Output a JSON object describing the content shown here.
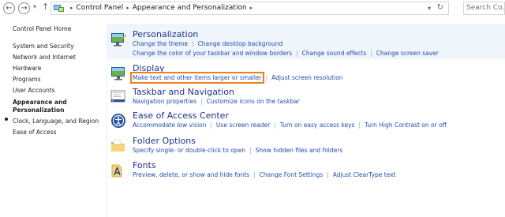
{
  "toolbar": {
    "back_icon": "back-arrow-icon",
    "forward_icon": "forward-arrow-icon",
    "recent_icon": "chevron-down-icon",
    "up_icon": "up-arrow-icon",
    "back_glyph": "←",
    "forward_glyph": "→",
    "recent_glyph": "▾",
    "up_glyph": "↑"
  },
  "address": {
    "crumbs": [
      "Control Panel",
      "Appearance and Personalization"
    ],
    "separator": "▸",
    "drop_glyph": "▾",
    "refresh_glyph": "↻"
  },
  "search": {
    "placeholder": "Search Co..."
  },
  "sidebar": {
    "items": [
      {
        "label": "Control Panel Home"
      },
      {
        "label": "System and Security"
      },
      {
        "label": "Network and Internet"
      },
      {
        "label": "Hardware"
      },
      {
        "label": "Programs"
      },
      {
        "label": "User Accounts"
      },
      {
        "label": "Appearance and"
      },
      {
        "label": "Personalization"
      },
      {
        "label": "Clock, Language, and Region"
      },
      {
        "label": "Ease of Access"
      }
    ]
  },
  "categories": [
    {
      "title": "Personalization",
      "icon": "personalization-icon",
      "lines": [
        [
          "Change the theme",
          "Change desktop background"
        ],
        [
          "Change the color of your taskbar and window borders",
          "Change sound effects",
          "Change screen saver"
        ]
      ]
    },
    {
      "title": "Display",
      "icon": "display-icon",
      "lines": [
        [
          "Make text and other items larger or smaller",
          "Adjust screen resolution"
        ]
      ]
    },
    {
      "title": "Taskbar and Navigation",
      "icon": "taskbar-icon",
      "lines": [
        [
          "Navigation properties",
          "Customize icons on the taskbar"
        ]
      ]
    },
    {
      "title": "Ease of Access Center",
      "icon": "ease-of-access-icon",
      "lines": [
        [
          "Accommodate low vision",
          "Use screen reader",
          "Turn on easy access keys",
          "Turn High Contrast on or off"
        ]
      ]
    },
    {
      "title": "Folder Options",
      "icon": "folder-icon",
      "lines": [
        [
          "Specify single- or double-click to open",
          "Show hidden files and folders"
        ]
      ]
    },
    {
      "title": "Fonts",
      "icon": "fonts-icon",
      "lines": [
        [
          "Preview, delete, or show and hide fonts",
          "Change Font Settings",
          "Adjust ClearType text"
        ]
      ]
    }
  ],
  "colors": {
    "link": "#1f4fa8",
    "title": "#1e3287",
    "highlight": "#f07d1e",
    "band": "#f0f5fc"
  }
}
